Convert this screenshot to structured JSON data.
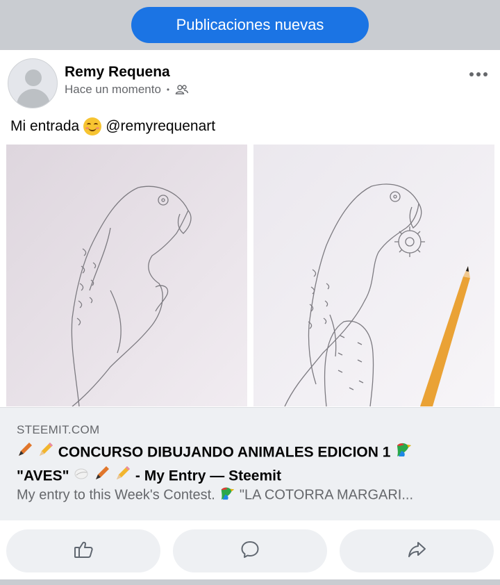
{
  "new_posts_button": {
    "label": "Publicaciones nuevas",
    "color": "#1b74e4"
  },
  "post": {
    "author": "Remy Requena",
    "time": "Hace un momento",
    "audience_icon": "friends-icon",
    "text_before": "Mi entrada",
    "text_after": "@remyrequenart",
    "images": [
      {
        "name": "parrot-sketch-1"
      },
      {
        "name": "parrot-sketch-2"
      }
    ]
  },
  "link_preview": {
    "domain": "STEEMIT.COM",
    "title_line1": "CONCURSO DIBUJANDO ANIMALES EDICION 1",
    "title_line2_a": "\"AVES\"",
    "title_line2_b": "- My Entry — Steemit",
    "description_before": "My entry to this Week's Contest.",
    "description_after": "\"LA COTORRA MARGARI..."
  },
  "actions": {
    "like_icon": "thumbs-up-icon",
    "comment_icon": "comment-icon",
    "share_icon": "share-icon"
  }
}
